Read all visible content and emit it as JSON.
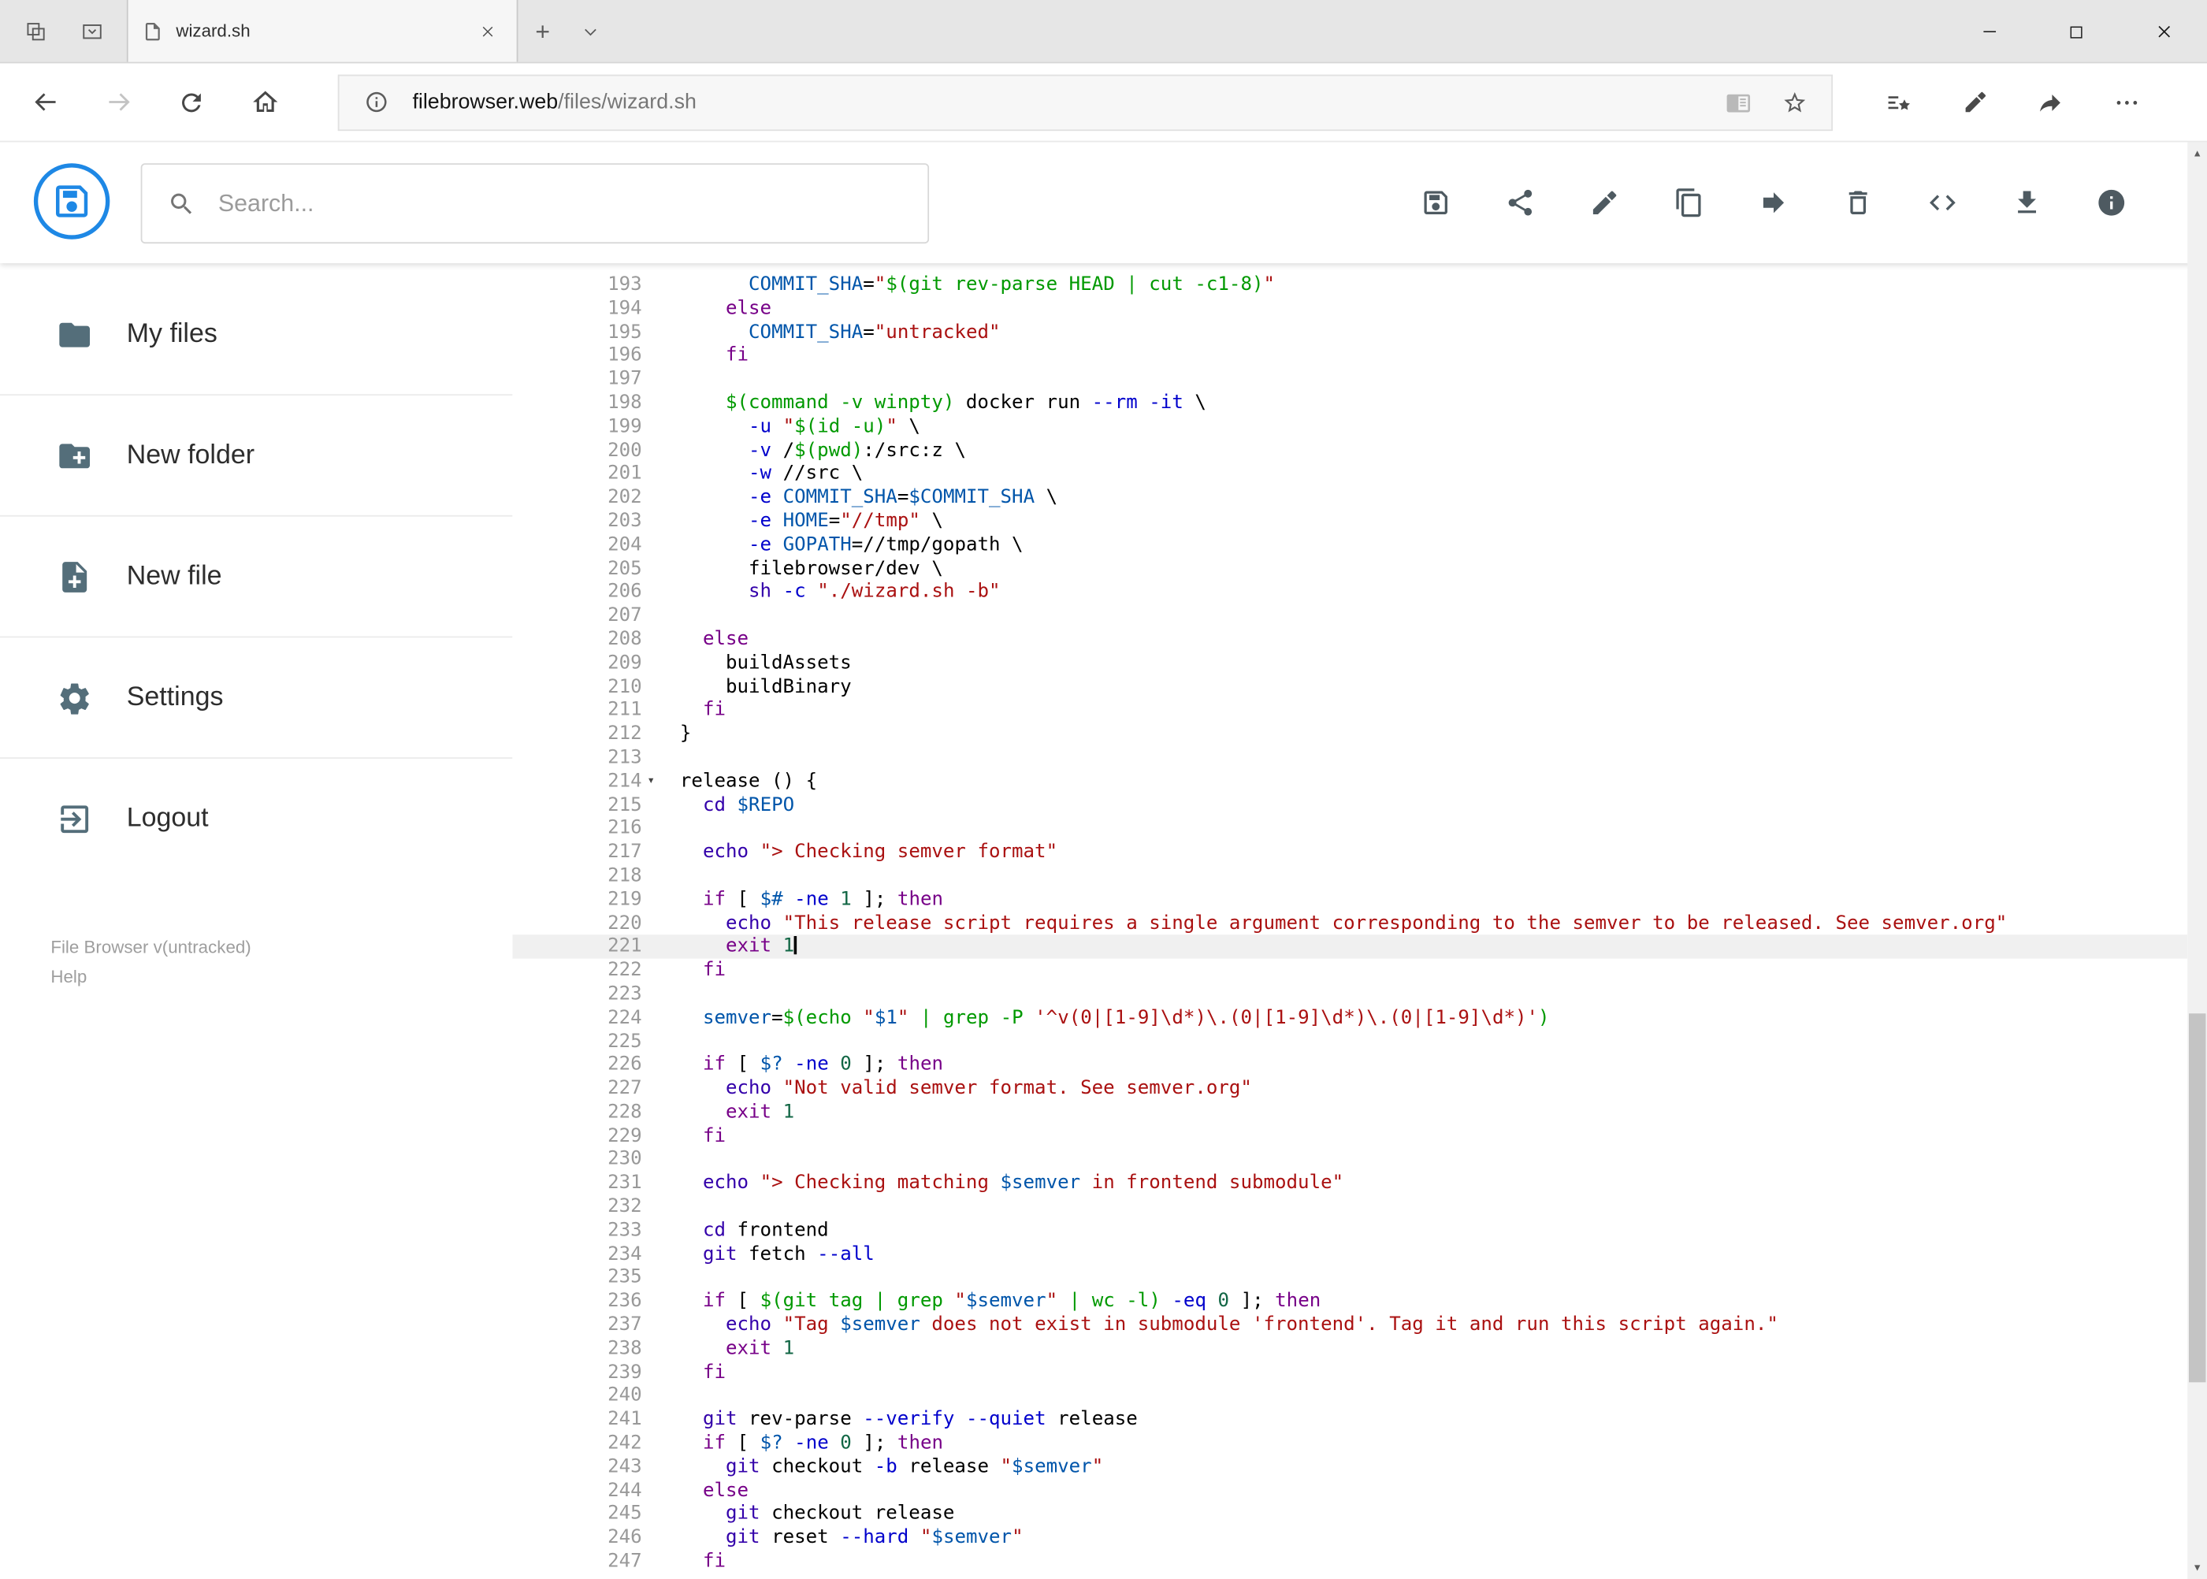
{
  "window": {
    "tab_title": "wizard.sh"
  },
  "browser": {
    "url_host": "filebrowser.web",
    "url_path": "/files/wizard.sh"
  },
  "app": {
    "search_placeholder": "Search...",
    "toolbar_icons": [
      "save-icon",
      "share-icon",
      "edit-icon",
      "copy-icon",
      "move-icon",
      "delete-icon",
      "code-icon",
      "download-icon",
      "info-icon"
    ]
  },
  "sidebar": {
    "items": [
      {
        "label": "My files",
        "icon": "folder-icon"
      },
      {
        "label": "New folder",
        "icon": "create-folder-icon"
      },
      {
        "label": "New file",
        "icon": "create-file-icon"
      },
      {
        "label": "Settings",
        "icon": "settings-icon"
      },
      {
        "label": "Logout",
        "icon": "logout-icon"
      }
    ],
    "footer_version": "File Browser v(untracked)",
    "footer_help": "Help"
  },
  "glyphs": {
    "fold_open": "▾",
    "scroll_up": "▲",
    "scroll_down": "▼"
  },
  "colors": {
    "accent_blue": "#1e88e5",
    "icon_gray": "#546e7a",
    "token_keyword": "#770088",
    "token_builtin": "#3300aa",
    "token_string": "#aa1111",
    "token_variable": "#0055aa",
    "token_number": "#116644",
    "token_attribute": "#0000cc",
    "token_quote": "#009900",
    "active_line_bg": "#f0f0f0",
    "gutter_color": "#999999"
  },
  "editor": {
    "language": "shell",
    "first_line": 193,
    "last_line": 247,
    "active_line": 221,
    "cursor_line": 221,
    "fold_marker_line": 214,
    "lines": [
      {
        "n": 193,
        "t": [
          [
            "p",
            "      "
          ],
          [
            "v",
            "COMMIT_SHA"
          ],
          [
            "p",
            "="
          ],
          [
            "s",
            "\""
          ],
          [
            "q",
            "$(git rev-parse HEAD | cut -c1-8)"
          ],
          [
            "s",
            "\""
          ]
        ]
      },
      {
        "n": 194,
        "t": [
          [
            "p",
            "    "
          ],
          [
            "k",
            "else"
          ]
        ]
      },
      {
        "n": 195,
        "t": [
          [
            "p",
            "      "
          ],
          [
            "v",
            "COMMIT_SHA"
          ],
          [
            "p",
            "="
          ],
          [
            "s",
            "\"untracked\""
          ]
        ]
      },
      {
        "n": 196,
        "t": [
          [
            "p",
            "    "
          ],
          [
            "k",
            "fi"
          ]
        ]
      },
      {
        "n": 197,
        "t": []
      },
      {
        "n": 198,
        "t": [
          [
            "p",
            "    "
          ],
          [
            "q",
            "$(command -v winpty)"
          ],
          [
            "p",
            " docker run "
          ],
          [
            "a",
            "--rm"
          ],
          [
            "p",
            " "
          ],
          [
            "a",
            "-it"
          ],
          [
            "p",
            " \\"
          ]
        ]
      },
      {
        "n": 199,
        "t": [
          [
            "p",
            "      "
          ],
          [
            "a",
            "-u"
          ],
          [
            "p",
            " "
          ],
          [
            "s",
            "\""
          ],
          [
            "q",
            "$(id -u)"
          ],
          [
            "s",
            "\""
          ],
          [
            "p",
            " \\"
          ]
        ]
      },
      {
        "n": 200,
        "t": [
          [
            "p",
            "      "
          ],
          [
            "a",
            "-v"
          ],
          [
            "p",
            " /"
          ],
          [
            "q",
            "$(pwd)"
          ],
          [
            "p",
            ":/src:z \\"
          ]
        ]
      },
      {
        "n": 201,
        "t": [
          [
            "p",
            "      "
          ],
          [
            "a",
            "-w"
          ],
          [
            "p",
            " //src \\"
          ]
        ]
      },
      {
        "n": 202,
        "t": [
          [
            "p",
            "      "
          ],
          [
            "a",
            "-e"
          ],
          [
            "p",
            " "
          ],
          [
            "v",
            "COMMIT_SHA"
          ],
          [
            "p",
            "="
          ],
          [
            "v",
            "$COMMIT_SHA"
          ],
          [
            "p",
            " \\"
          ]
        ]
      },
      {
        "n": 203,
        "t": [
          [
            "p",
            "      "
          ],
          [
            "a",
            "-e"
          ],
          [
            "p",
            " "
          ],
          [
            "v",
            "HOME"
          ],
          [
            "p",
            "="
          ],
          [
            "s",
            "\"//tmp\""
          ],
          [
            "p",
            " \\"
          ]
        ]
      },
      {
        "n": 204,
        "t": [
          [
            "p",
            "      "
          ],
          [
            "a",
            "-e"
          ],
          [
            "p",
            " "
          ],
          [
            "v",
            "GOPATH"
          ],
          [
            "p",
            "=//tmp/gopath \\"
          ]
        ]
      },
      {
        "n": 205,
        "t": [
          [
            "p",
            "      filebrowser/dev \\"
          ]
        ]
      },
      {
        "n": 206,
        "t": [
          [
            "p",
            "      "
          ],
          [
            "b",
            "sh"
          ],
          [
            "p",
            " "
          ],
          [
            "a",
            "-c"
          ],
          [
            "p",
            " "
          ],
          [
            "s",
            "\"./wizard.sh -b\""
          ]
        ]
      },
      {
        "n": 207,
        "t": []
      },
      {
        "n": 208,
        "t": [
          [
            "p",
            "  "
          ],
          [
            "k",
            "else"
          ]
        ]
      },
      {
        "n": 209,
        "t": [
          [
            "p",
            "    buildAssets"
          ]
        ]
      },
      {
        "n": 210,
        "t": [
          [
            "p",
            "    buildBinary"
          ]
        ]
      },
      {
        "n": 211,
        "t": [
          [
            "p",
            "  "
          ],
          [
            "k",
            "fi"
          ]
        ]
      },
      {
        "n": 212,
        "t": [
          [
            "p",
            "}"
          ]
        ]
      },
      {
        "n": 213,
        "t": []
      },
      {
        "n": 214,
        "t": [
          [
            "p",
            "release () {"
          ]
        ]
      },
      {
        "n": 215,
        "t": [
          [
            "p",
            "  "
          ],
          [
            "b",
            "cd"
          ],
          [
            "p",
            " "
          ],
          [
            "v",
            "$REPO"
          ]
        ]
      },
      {
        "n": 216,
        "t": []
      },
      {
        "n": 217,
        "t": [
          [
            "p",
            "  "
          ],
          [
            "b",
            "echo"
          ],
          [
            "p",
            " "
          ],
          [
            "s",
            "\"> Checking semver format\""
          ]
        ]
      },
      {
        "n": 218,
        "t": []
      },
      {
        "n": 219,
        "t": [
          [
            "p",
            "  "
          ],
          [
            "k",
            "if"
          ],
          [
            "p",
            " [ "
          ],
          [
            "v",
            "$#"
          ],
          [
            "p",
            " "
          ],
          [
            "a",
            "-ne"
          ],
          [
            "p",
            " "
          ],
          [
            "n",
            "1"
          ],
          [
            "p",
            " ]; "
          ],
          [
            "k",
            "then"
          ]
        ]
      },
      {
        "n": 220,
        "t": [
          [
            "p",
            "    "
          ],
          [
            "b",
            "echo"
          ],
          [
            "p",
            " "
          ],
          [
            "s",
            "\"This release script requires a single argument corresponding to the semver to be released. See semver.org\""
          ]
        ]
      },
      {
        "n": 221,
        "t": [
          [
            "p",
            "    "
          ],
          [
            "k",
            "exit"
          ],
          [
            "p",
            " "
          ],
          [
            "n",
            "1"
          ]
        ]
      },
      {
        "n": 222,
        "t": [
          [
            "p",
            "  "
          ],
          [
            "k",
            "fi"
          ]
        ]
      },
      {
        "n": 223,
        "t": []
      },
      {
        "n": 224,
        "t": [
          [
            "p",
            "  "
          ],
          [
            "v",
            "semver"
          ],
          [
            "p",
            "="
          ],
          [
            "q",
            "$(echo "
          ],
          [
            "s",
            "\""
          ],
          [
            "v",
            "$1"
          ],
          [
            "s",
            "\""
          ],
          [
            "q",
            " | grep -P "
          ],
          [
            "s",
            "'^v(0|[1-9]\\d*)\\.(0|[1-9]\\d*)\\.(0|[1-9]\\d*)'"
          ],
          [
            "q",
            ")"
          ]
        ]
      },
      {
        "n": 225,
        "t": []
      },
      {
        "n": 226,
        "t": [
          [
            "p",
            "  "
          ],
          [
            "k",
            "if"
          ],
          [
            "p",
            " [ "
          ],
          [
            "v",
            "$?"
          ],
          [
            "p",
            " "
          ],
          [
            "a",
            "-ne"
          ],
          [
            "p",
            " "
          ],
          [
            "n",
            "0"
          ],
          [
            "p",
            " ]; "
          ],
          [
            "k",
            "then"
          ]
        ]
      },
      {
        "n": 227,
        "t": [
          [
            "p",
            "    "
          ],
          [
            "b",
            "echo"
          ],
          [
            "p",
            " "
          ],
          [
            "s",
            "\"Not valid semver format. See semver.org\""
          ]
        ]
      },
      {
        "n": 228,
        "t": [
          [
            "p",
            "    "
          ],
          [
            "k",
            "exit"
          ],
          [
            "p",
            " "
          ],
          [
            "n",
            "1"
          ]
        ]
      },
      {
        "n": 229,
        "t": [
          [
            "p",
            "  "
          ],
          [
            "k",
            "fi"
          ]
        ]
      },
      {
        "n": 230,
        "t": []
      },
      {
        "n": 231,
        "t": [
          [
            "p",
            "  "
          ],
          [
            "b",
            "echo"
          ],
          [
            "p",
            " "
          ],
          [
            "s",
            "\"> Checking matching "
          ],
          [
            "v",
            "$semver"
          ],
          [
            "s",
            " in frontend submodule\""
          ]
        ]
      },
      {
        "n": 232,
        "t": []
      },
      {
        "n": 233,
        "t": [
          [
            "p",
            "  "
          ],
          [
            "b",
            "cd"
          ],
          [
            "p",
            " frontend"
          ]
        ]
      },
      {
        "n": 234,
        "t": [
          [
            "p",
            "  "
          ],
          [
            "b",
            "git"
          ],
          [
            "p",
            " fetch "
          ],
          [
            "a",
            "--all"
          ]
        ]
      },
      {
        "n": 235,
        "t": []
      },
      {
        "n": 236,
        "t": [
          [
            "p",
            "  "
          ],
          [
            "k",
            "if"
          ],
          [
            "p",
            " [ "
          ],
          [
            "q",
            "$(git tag | grep "
          ],
          [
            "s",
            "\""
          ],
          [
            "v",
            "$semver"
          ],
          [
            "s",
            "\""
          ],
          [
            "q",
            " | wc -l)"
          ],
          [
            "p",
            " "
          ],
          [
            "a",
            "-eq"
          ],
          [
            "p",
            " "
          ],
          [
            "n",
            "0"
          ],
          [
            "p",
            " ]; "
          ],
          [
            "k",
            "then"
          ]
        ]
      },
      {
        "n": 237,
        "t": [
          [
            "p",
            "    "
          ],
          [
            "b",
            "echo"
          ],
          [
            "p",
            " "
          ],
          [
            "s",
            "\"Tag "
          ],
          [
            "v",
            "$semver"
          ],
          [
            "s",
            " does not exist in submodule 'frontend'. Tag it and run this script again.\""
          ]
        ]
      },
      {
        "n": 238,
        "t": [
          [
            "p",
            "    "
          ],
          [
            "k",
            "exit"
          ],
          [
            "p",
            " "
          ],
          [
            "n",
            "1"
          ]
        ]
      },
      {
        "n": 239,
        "t": [
          [
            "p",
            "  "
          ],
          [
            "k",
            "fi"
          ]
        ]
      },
      {
        "n": 240,
        "t": []
      },
      {
        "n": 241,
        "t": [
          [
            "p",
            "  "
          ],
          [
            "b",
            "git"
          ],
          [
            "p",
            " rev-parse "
          ],
          [
            "a",
            "--verify"
          ],
          [
            "p",
            " "
          ],
          [
            "a",
            "--quiet"
          ],
          [
            "p",
            " release"
          ]
        ]
      },
      {
        "n": 242,
        "t": [
          [
            "p",
            "  "
          ],
          [
            "k",
            "if"
          ],
          [
            "p",
            " [ "
          ],
          [
            "v",
            "$?"
          ],
          [
            "p",
            " "
          ],
          [
            "a",
            "-ne"
          ],
          [
            "p",
            " "
          ],
          [
            "n",
            "0"
          ],
          [
            "p",
            " ]; "
          ],
          [
            "k",
            "then"
          ]
        ]
      },
      {
        "n": 243,
        "t": [
          [
            "p",
            "    "
          ],
          [
            "b",
            "git"
          ],
          [
            "p",
            " checkout "
          ],
          [
            "a",
            "-b"
          ],
          [
            "p",
            " release "
          ],
          [
            "s",
            "\""
          ],
          [
            "v",
            "$semver"
          ],
          [
            "s",
            "\""
          ]
        ]
      },
      {
        "n": 244,
        "t": [
          [
            "p",
            "  "
          ],
          [
            "k",
            "else"
          ]
        ]
      },
      {
        "n": 245,
        "t": [
          [
            "p",
            "    "
          ],
          [
            "b",
            "git"
          ],
          [
            "p",
            " checkout release"
          ]
        ]
      },
      {
        "n": 246,
        "t": [
          [
            "p",
            "    "
          ],
          [
            "b",
            "git"
          ],
          [
            "p",
            " reset "
          ],
          [
            "a",
            "--hard"
          ],
          [
            "p",
            " "
          ],
          [
            "s",
            "\""
          ],
          [
            "v",
            "$semver"
          ],
          [
            "s",
            "\""
          ]
        ]
      },
      {
        "n": 247,
        "t": [
          [
            "p",
            "  "
          ],
          [
            "k",
            "fi"
          ]
        ]
      }
    ]
  }
}
